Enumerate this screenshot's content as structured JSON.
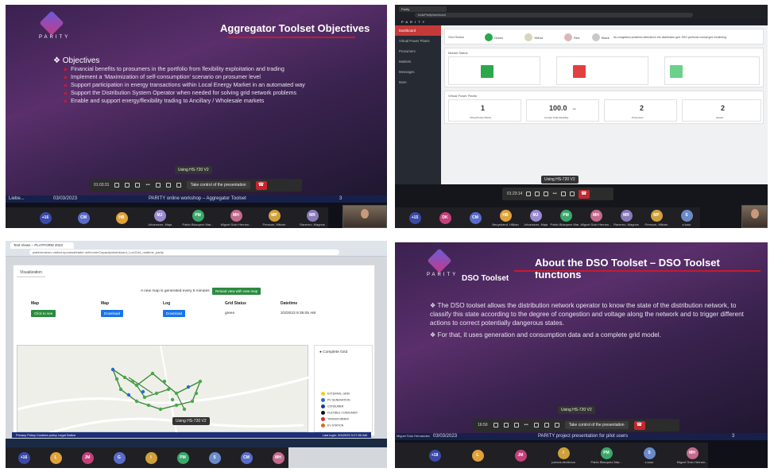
{
  "panels": {
    "p1": {
      "logo_text": "PARITY",
      "title": "Aggregator Toolset Objectives",
      "heading": "Objectives",
      "bullets": [
        "Financial benefits to prosumers in the portfolio from flexibility exploitation and trading",
        "Implement a ‘Maximization of self-consumption’ scenario on prosumer level",
        "Support participation in energy transactions within Local Energy Market in an automated way",
        "Support the Distribution System Operator when needed for solving grid network problems",
        "Enable and support energy/flexibility trading to Ancillary / Wholesale markets"
      ],
      "tooltip": "Using HS-720 V2",
      "toolbar_time": "01:03:31",
      "toolbar_action": "Take control of the presentation",
      "footer_date": "03/03/2023",
      "footer_text": "PARITY online workshop – Aggregator Toolset",
      "footer_page": "3",
      "footer_left": "Liebe...",
      "participants": [
        {
          "initials": "+16",
          "color": "#3b4aa8"
        },
        {
          "initials": "CM",
          "color": "#5a6cc8"
        },
        {
          "initials": "HB",
          "color": "#e0a23a"
        },
        {
          "initials": "MJ",
          "color": "#9a8ad0",
          "name": "Johansson, Maja"
        },
        {
          "initials": "PM",
          "color": "#3aa86a",
          "name": "Pablo Blazquez Mar..."
        },
        {
          "initials": "MH",
          "color": "#c46a8a",
          "name": "Miguel Soto Hernan..."
        },
        {
          "initials": "MP",
          "color": "#d0a03a",
          "name": "Persson, Mikrán"
        },
        {
          "initials": "MR",
          "color": "#8a7ab8",
          "name": "Ranerno, Magnus"
        }
      ]
    },
    "p2": {
      "chrome_tab": "Parity",
      "url": "tools/Parity/dashboard",
      "sidebar": [
        "Dashboard",
        "Virtual Power Plants",
        "Prosumers",
        "Markets",
        "Messages",
        "More"
      ],
      "grid_status_label": "Grid Status",
      "status_items": [
        "Green",
        "Yellow",
        "Red",
        "Black"
      ],
      "status_note": "No congestion problems detected in the distribution grid. DSO performs normal grid monitoring.",
      "market_status_label": "Market Status",
      "virtual_plants_label": "Virtual Power Plants",
      "stats": [
        {
          "value": "1",
          "caption": "Virtual Power Plants"
        },
        {
          "value": "100.0",
          "unit": "kw",
          "caption": "Current Total Flexibility"
        },
        {
          "value": "2",
          "caption": "Prosumers"
        },
        {
          "value": "2",
          "caption": "Assets"
        }
      ],
      "tooltip": "Using HS-720 V2",
      "toolbar_time": "01:23:14",
      "participants": [
        {
          "initials": "+15",
          "color": "#3b4aa8"
        },
        {
          "initials": "DK",
          "color": "#c4407a"
        },
        {
          "initials": "CM",
          "color": "#5a6cc8"
        },
        {
          "initials": "HB",
          "color": "#e0a23a",
          "name": "Bergstrand, Håkan"
        },
        {
          "initials": "MJ",
          "color": "#9a8ad0",
          "name": "Johansson, Maja"
        },
        {
          "initials": "PM",
          "color": "#3aa86a",
          "name": "Pablo Blazquez Mar..."
        },
        {
          "initials": "MH",
          "color": "#c46a8a",
          "name": "Miguel Soto Hernan..."
        },
        {
          "initials": "MR",
          "color": "#8a7ab8",
          "name": "Ranerno, Magnus"
        },
        {
          "initials": "MP",
          "color": "#d0a03a",
          "name": "Persson, Mikrán"
        },
        {
          "initials": "S",
          "color": "#6a8ac8",
          "name": "s.kaur"
        }
      ]
    },
    "p3": {
      "tab_title": "Test Views – PLATFORM 2023",
      "url": "platformdemo.visited.eponesafetabe.net/home/Capacity/dashboard_Loc/Grid_realtime_parity",
      "section_tab": "Visualization",
      "refresh_note": "A new map is generated every 5 minutes",
      "reload_button": "Reload view with new map",
      "columns": [
        "Map",
        "Map",
        "Log",
        "Grid Status",
        "Datetime"
      ],
      "row": {
        "view": "Click to see",
        "map": "Download",
        "log": "Download",
        "status": "green",
        "datetime": "3/3/2023 9:35:05 AM"
      },
      "legend_title": "Complete Grid",
      "legend_items": [
        {
          "label": "EXTERNAL GRID",
          "color": "#f0d020"
        },
        {
          "label": "PV GENERATION",
          "color": "#2a6ad0"
        },
        {
          "label": "CONSUMER",
          "color": "#1a3a8a"
        },
        {
          "label": "FLEXIBLE CONSUMER",
          "color": "#111111"
        },
        {
          "label": "TRANSFORMER",
          "color": "#d03030"
        },
        {
          "label": "EV STATION",
          "color": "#d07020"
        }
      ],
      "statusbar_left": "Privacy Policy  Cookies policy  Legal Notice",
      "statusbar_right": "Last login: 3/3/2023 9:27:55 AM",
      "tooltip": "Using HS-720 V2",
      "participants": [
        {
          "initials": "+16",
          "color": "#3b4aa8"
        },
        {
          "initials": "L",
          "color": "#e0a23a"
        },
        {
          "initials": "JM",
          "color": "#c4407a"
        },
        {
          "initials": "G",
          "color": "#5a6cc8"
        },
        {
          "initials": "I",
          "color": "#d0a03a"
        },
        {
          "initials": "PM",
          "color": "#3aa86a"
        },
        {
          "initials": "S",
          "color": "#6a8ac8"
        },
        {
          "initials": "CM",
          "color": "#5a6cc8"
        },
        {
          "initials": "MH",
          "color": "#c46a8a"
        }
      ]
    },
    "p4": {
      "logo_text": "PARITY",
      "title": "About the DSO Toolset – DSO Toolset functions",
      "subtitle": "DSO Toolset",
      "paragraphs": [
        "The DSO toolset allows the distribution network operator to know the state of the distribution network, to classify this state according to the degree of congestion and voltage along the network and to trigger different actions to correct potentially dangerous states.",
        "For that, it uses generation and consumption data and a complete grid model."
      ],
      "tooltip": "Using HS-720 V2",
      "toolbar_time": "16:50",
      "toolbar_action": "Take control of the presentation",
      "footer_date": "03/03/2023",
      "footer_text": "PARITY project presentation for pilot users",
      "footer_page": "3",
      "footer_left": "Miguel Soto Hernandez",
      "participants": [
        {
          "initials": "+18",
          "color": "#3b4aa8"
        },
        {
          "initials": "L",
          "color": "#e0a23a"
        },
        {
          "initials": "JM",
          "color": "#c4407a"
        },
        {
          "initials": "I",
          "color": "#d0a03a",
          "name": "joanna.dimitrova"
        },
        {
          "initials": "PM",
          "color": "#3aa86a",
          "name": "Pablo Blazquez Mar..."
        },
        {
          "initials": "S",
          "color": "#6a8ac8",
          "name": "s.kaur"
        },
        {
          "initials": "MH",
          "color": "#c46a8a",
          "name": "Miguel Soto Hernan..."
        }
      ]
    }
  }
}
